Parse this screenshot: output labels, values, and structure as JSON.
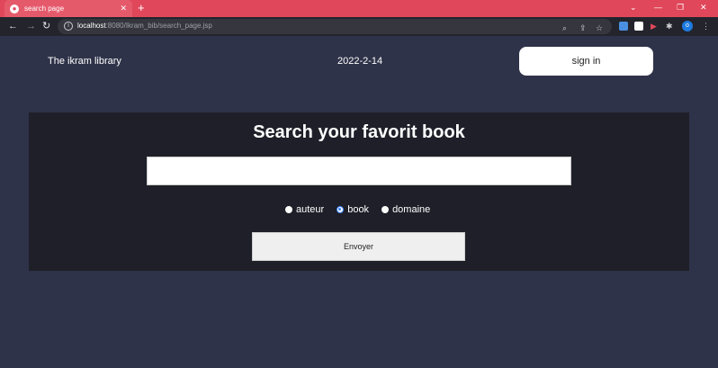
{
  "browser": {
    "tab_title": "search page",
    "url_host": "localhost",
    "url_rest": ":8080/Ikram_bib/search_page.jsp",
    "icons": [
      "back-icon",
      "forward-icon",
      "reload-icon",
      "site-info-icon",
      "zoom-icon",
      "share-icon",
      "bookmark-star-icon",
      "extensions-icon",
      "profile-avatar",
      "menu-kebab-icon"
    ],
    "profile_initial": "o",
    "accent": "#e0475a"
  },
  "header": {
    "brand": "The ikram library",
    "date": "2022-2-14",
    "signin_label": "sign in"
  },
  "search": {
    "heading": "Search your favorit book",
    "input_value": "",
    "options": [
      {
        "label": "auteur",
        "checked": false
      },
      {
        "label": "book",
        "checked": true
      },
      {
        "label": "domaine",
        "checked": false
      }
    ],
    "submit_label": "Envoyer"
  },
  "colors": {
    "page_bg": "#2f3349",
    "panel_bg": "#1e1f28",
    "radio_checked": "#3b82f6"
  }
}
